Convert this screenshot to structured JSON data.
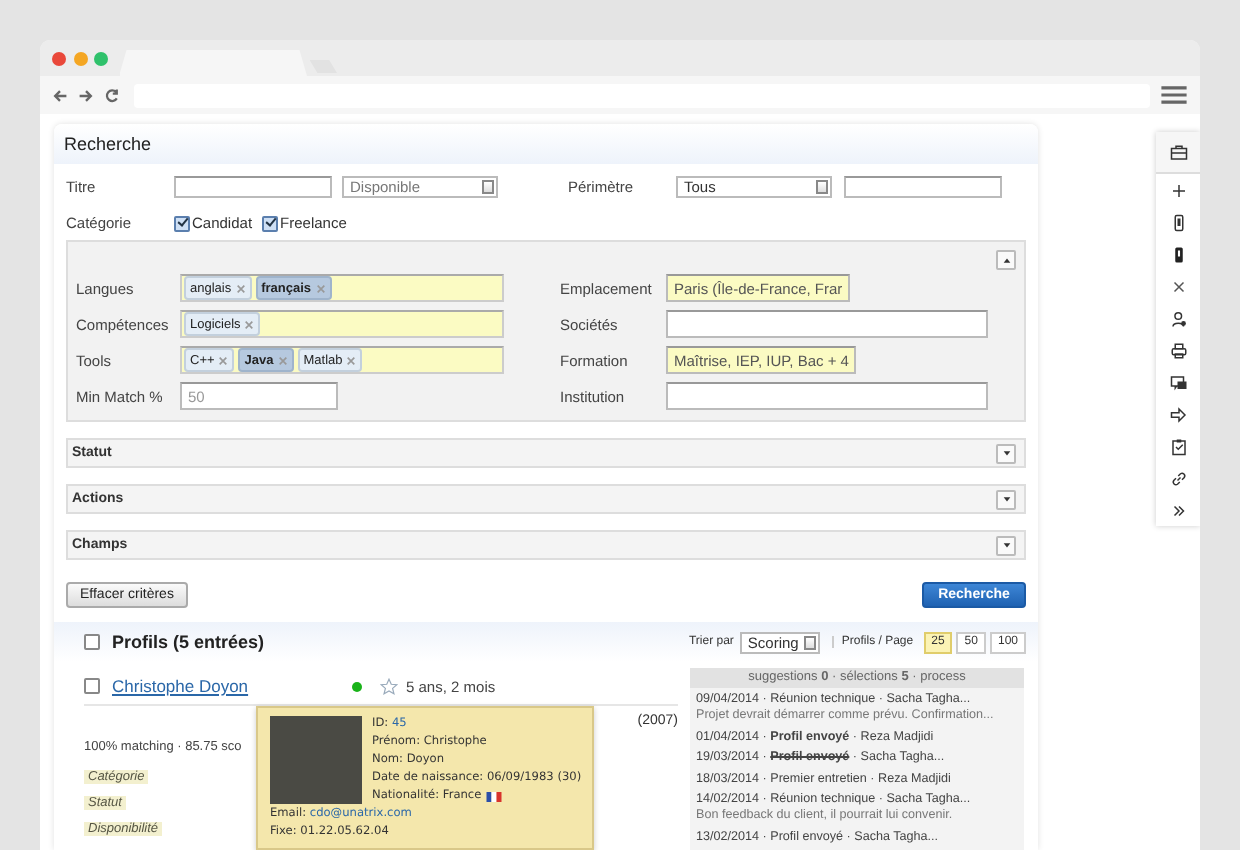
{
  "search_panel": {
    "title": "Recherche",
    "titre": {
      "label": "Titre"
    },
    "availability": {
      "value": "Disponible"
    },
    "perimetre": {
      "label": "Périmètre",
      "value": "Tous"
    },
    "categorie": {
      "label": "Catégorie",
      "options": [
        {
          "label": "Candidat",
          "checked": true
        },
        {
          "label": "Freelance",
          "checked": true
        }
      ]
    },
    "criteria": {
      "expanded": true,
      "rows": [
        {
          "left": {
            "label": "Langues",
            "kind": "tags",
            "tags": [
              {
                "text": "anglais",
                "selected": false
              },
              {
                "text": "français",
                "selected": true
              }
            ]
          },
          "right": {
            "label": "Emplacement",
            "kind": "text",
            "value": "Paris (Île-de-France, Frar",
            "highlighted": true
          }
        },
        {
          "left": {
            "label": "Compétences",
            "kind": "tags",
            "tags": [
              {
                "text": "Logiciels",
                "selected": false
              }
            ]
          },
          "right": {
            "label": "Sociétés",
            "kind": "text",
            "highlighted": false
          }
        },
        {
          "left": {
            "label": "Tools",
            "kind": "tags",
            "tags": [
              {
                "text": "C++",
                "selected": false
              },
              {
                "text": "Java",
                "selected": true
              },
              {
                "text": "Matlab",
                "selected": false
              }
            ]
          },
          "right": {
            "label": "Formation",
            "kind": "text",
            "value": "Maîtrise, IEP, IUP, Bac + 4",
            "highlighted": true
          }
        },
        {
          "left": {
            "label": "Min Match %",
            "kind": "text",
            "placeholder": "50",
            "highlighted": false
          },
          "right": {
            "label": "Institution",
            "kind": "text",
            "highlighted": false
          }
        }
      ]
    },
    "sections": [
      {
        "title": "Statut",
        "expanded": false
      },
      {
        "title": "Actions",
        "expanded": false
      },
      {
        "title": "Champs",
        "expanded": false
      }
    ],
    "clear_button": "Effacer critères",
    "search_button": "Recherche"
  },
  "results": {
    "title": "Profils (5 entrées)",
    "checked": false,
    "sort_label": "Trier par",
    "sort_value": "Scoring",
    "per_page_label": "Profils / Page",
    "page_sizes": [
      {
        "label": "25",
        "selected": true
      },
      {
        "label": "50",
        "selected": false
      },
      {
        "label": "100",
        "selected": false
      }
    ],
    "profiles": [
      {
        "name": "Christophe Doyon",
        "checked": false,
        "online": true,
        "starred": false,
        "experience": "5 ans, 2 mois",
        "column_3": "(2007)",
        "match": "100% matching · 85.75 sco",
        "tags": [
          "Catégorie",
          "Statut",
          "Disponibilité"
        ],
        "history": {
          "header": "suggestions **0** · sélections **5** · process",
          "separator": "·",
          "entries": [
            {
              "date": "09/04/2014",
              "event": "Réunion technique",
              "kind": "plain",
              "person": "Sacha Tagha...",
              "note": "Projet devrait démarrer comme prévu. Confirmation..."
            },
            {
              "date": "01/04/2014",
              "event": "Profil envoyé",
              "kind": "bold",
              "person": "Reza Madjidi"
            },
            {
              "date": "19/03/2014",
              "event": "Profil envoyé",
              "kind": "struck",
              "person": "Sacha Tagha..."
            },
            {
              "date": "18/03/2014",
              "event": "Premier entretien",
              "kind": "plain",
              "person": "Reza Madjidi"
            },
            {
              "date": "14/02/2014",
              "event": "Réunion technique",
              "kind": "plain",
              "person": "Sacha Tagha...",
              "note": "Bon feedback du client, il pourrait lui convenir."
            },
            {
              "date": "13/02/2014",
              "event": "Profil envoyé",
              "kind": "plain",
              "person": "Sacha Tagha..."
            }
          ]
        },
        "tooltip": {
          "id_label": "ID:",
          "id": "45",
          "lines": [
            "Prénom: Christophe",
            "Nom: Doyon",
            "Date de naissance: 06/09/1983 (30)"
          ],
          "nationality": "Nationalité: France",
          "email_label": "Email:",
          "email": "cdo@unatrix.com",
          "phone": "Fixe: 01.22.05.62.04"
        }
      }
    ]
  }
}
